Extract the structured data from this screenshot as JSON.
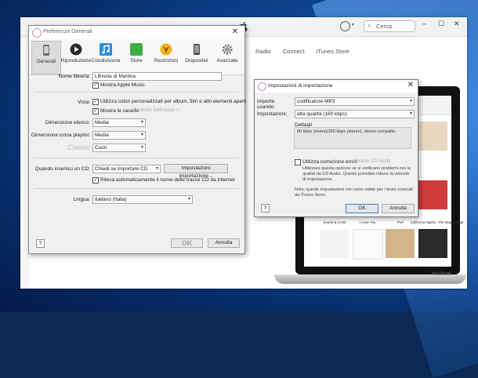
{
  "itunes": {
    "search_placeholder": "Cerca",
    "nav": [
      "Radio",
      "Connect",
      "iTunes Store"
    ],
    "window_controls": [
      "–",
      "☐",
      "✕"
    ]
  },
  "macbook": {
    "brand": "MacBook",
    "albums": [
      "Sound & Color",
      "I Love You",
      "Purl",
      "California Nights",
      "The Magic Whip"
    ]
  },
  "prefs": {
    "title": "Preferenze Generali",
    "toolbar": [
      {
        "label": "Generali",
        "icon": "iphone-icon",
        "color": "#7a7a7a"
      },
      {
        "label": "Riproduzione",
        "icon": "play-icon",
        "color": "#2a2a2a"
      },
      {
        "label": "Condivisione",
        "icon": "music-note-icon",
        "color": "#2f8ed8"
      },
      {
        "label": "Store",
        "icon": "store-icon",
        "color": "#3cb043"
      },
      {
        "label": "Restrizioni",
        "icon": "restrictions-icon",
        "color": "#f2b418"
      },
      {
        "label": "Dispositivi",
        "icon": "device-icon",
        "color": "#555555"
      },
      {
        "label": "Avanzate",
        "icon": "gear-icon",
        "color": "#777777"
      }
    ],
    "library_label": "Nome libreria:",
    "library_value": "Libreria di Martina",
    "show_apple_music": "Mostra Apple Music",
    "view_label": "Vista:",
    "custom_colors": "Utilizza colori personalizzati per album, film e altri elementi aperti",
    "show_checkboxes": "Mostra le caselle",
    "ghost_text": "Controllo Definizioni >",
    "list_size_label": "Dimensione elenco:",
    "list_size_value": "Media",
    "playlist_icon_label": "Dimensione icona playlist:",
    "playlist_icon_value": "Media",
    "classic_label": "Classic",
    "grid_value": "Cuori",
    "cd_insert_label": "Quando inserisci un CD:",
    "cd_insert_value": "Chiedi se importare CD",
    "import_settings_button": "Impostazioni importazione...",
    "auto_names": "Rileva automaticamente il nome delle tracce CD da Internet",
    "language_label": "Lingua:",
    "language_value": "Italiano (Italia)",
    "help": "?",
    "ok": "OK",
    "cancel": "Annulla"
  },
  "import": {
    "title": "Impostazioni di importazione",
    "import_using_label": "Importa usando:",
    "import_using_value": "codificatore MP3",
    "settings_label": "Impostazioni:",
    "settings_value": "alta qualità (160 kbps)",
    "details_label": "Dettagli",
    "details_text": "80 kbps (mono)/160 kbps (stereo), stereo compatto.",
    "error_correction": "Utilizza correzione errori",
    "error_ghost": "durante CD Audio",
    "error_desc": "Utilizzare questa opzione se si verificano problemi con la qualità da CD Audio. Questo potrebbe ridurre la velocità di importazione.",
    "note": "Nota: queste impostazioni non sono valide per i brani scaricati da iTunes Store.",
    "help": "?",
    "ok": "OK",
    "cancel": "Annulla"
  }
}
